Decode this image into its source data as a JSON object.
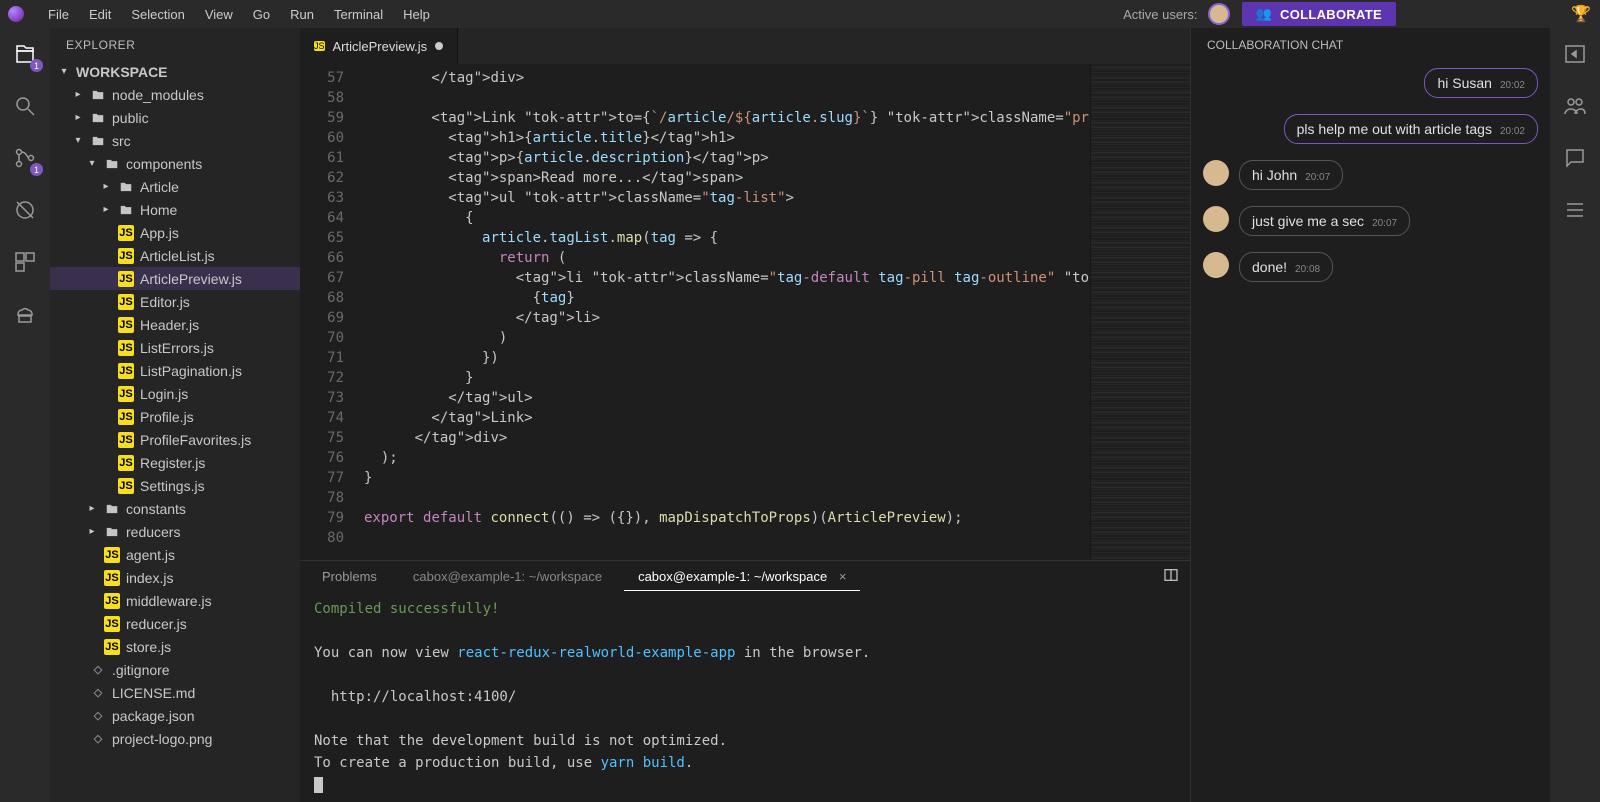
{
  "menu": {
    "items": [
      "File",
      "Edit",
      "Selection",
      "View",
      "Go",
      "Run",
      "Terminal",
      "Help"
    ],
    "activeUsersLabel": "Active users:",
    "collabButton": "COLLABORATE"
  },
  "explorer": {
    "title": "EXPLORER",
    "section": "WORKSPACE",
    "tree": [
      {
        "type": "folder",
        "label": "node_modules",
        "depth": 1,
        "open": false
      },
      {
        "type": "folder",
        "label": "public",
        "depth": 1,
        "open": false
      },
      {
        "type": "folder",
        "label": "src",
        "depth": 1,
        "open": true
      },
      {
        "type": "folder",
        "label": "components",
        "depth": 2,
        "open": true
      },
      {
        "type": "folder",
        "label": "Article",
        "depth": 3,
        "open": false
      },
      {
        "type": "folder",
        "label": "Home",
        "depth": 3,
        "open": false
      },
      {
        "type": "file",
        "label": "App.js",
        "depth": 3,
        "icon": "js"
      },
      {
        "type": "file",
        "label": "ArticleList.js",
        "depth": 3,
        "icon": "js"
      },
      {
        "type": "file",
        "label": "ArticlePreview.js",
        "depth": 3,
        "icon": "js",
        "selected": true
      },
      {
        "type": "file",
        "label": "Editor.js",
        "depth": 3,
        "icon": "js"
      },
      {
        "type": "file",
        "label": "Header.js",
        "depth": 3,
        "icon": "js"
      },
      {
        "type": "file",
        "label": "ListErrors.js",
        "depth": 3,
        "icon": "js"
      },
      {
        "type": "file",
        "label": "ListPagination.js",
        "depth": 3,
        "icon": "js"
      },
      {
        "type": "file",
        "label": "Login.js",
        "depth": 3,
        "icon": "js"
      },
      {
        "type": "file",
        "label": "Profile.js",
        "depth": 3,
        "icon": "js"
      },
      {
        "type": "file",
        "label": "ProfileFavorites.js",
        "depth": 3,
        "icon": "js"
      },
      {
        "type": "file",
        "label": "Register.js",
        "depth": 3,
        "icon": "js"
      },
      {
        "type": "file",
        "label": "Settings.js",
        "depth": 3,
        "icon": "js"
      },
      {
        "type": "folder",
        "label": "constants",
        "depth": 2,
        "open": false
      },
      {
        "type": "folder",
        "label": "reducers",
        "depth": 2,
        "open": false
      },
      {
        "type": "file",
        "label": "agent.js",
        "depth": 2,
        "icon": "js"
      },
      {
        "type": "file",
        "label": "index.js",
        "depth": 2,
        "icon": "js"
      },
      {
        "type": "file",
        "label": "middleware.js",
        "depth": 2,
        "icon": "js"
      },
      {
        "type": "file",
        "label": "reducer.js",
        "depth": 2,
        "icon": "js"
      },
      {
        "type": "file",
        "label": "store.js",
        "depth": 2,
        "icon": "js"
      },
      {
        "type": "file",
        "label": ".gitignore",
        "depth": 1,
        "icon": "generic"
      },
      {
        "type": "file",
        "label": "LICENSE.md",
        "depth": 1,
        "icon": "generic"
      },
      {
        "type": "file",
        "label": "package.json",
        "depth": 1,
        "icon": "generic"
      },
      {
        "type": "file",
        "label": "project-logo.png",
        "depth": 1,
        "icon": "generic"
      }
    ]
  },
  "activity": {
    "explorerBadge": "1",
    "scmBadge": "1"
  },
  "editor": {
    "tab": "ArticlePreview.js",
    "startLine": 57,
    "lines": [
      "        </div>",
      "",
      "        <Link to={`/article/${article.slug}`} className=\"preview-link\">",
      "          <h1>{article.title}</h1>",
      "          <p>{article.description}</p>",
      "          <span>Read more...</span>",
      "          <ul className=\"tag-list\">",
      "            {",
      "              article.tagList.map(tag => {",
      "                return (",
      "                  <li className=\"tag-default tag-pill tag-outline\" key={tag}>",
      "                    {tag}",
      "                  </li>",
      "                )",
      "              })",
      "            }",
      "          </ul>",
      "        </Link>",
      "      </div>",
      "  );",
      "}",
      "",
      "export default connect(() => ({}), mapDispatchToProps)(ArticlePreview);",
      ""
    ]
  },
  "panel": {
    "tabs": {
      "problems": "Problems",
      "term1": "cabox@example-1: ~/workspace",
      "term2": "cabox@example-1: ~/workspace"
    },
    "terminal": {
      "line1": "Compiled successfully!",
      "line2a": "You can now view ",
      "line2b": "react-redux-realworld-example-app",
      "line2c": " in the browser.",
      "line3": "  http://localhost:4100/",
      "line4": "Note that the development build is not optimized.",
      "line5a": "To create a production build, use ",
      "line5b": "yarn build",
      "line5c": "."
    }
  },
  "chat": {
    "title": "COLLABORATION CHAT",
    "messages": [
      {
        "side": "right",
        "text": "hi Susan",
        "time": "20:02"
      },
      {
        "side": "right",
        "text": "pls help me out with article tags",
        "time": "20:02"
      },
      {
        "side": "left",
        "text": "hi John",
        "time": "20:07"
      },
      {
        "side": "left",
        "text": "just give me a sec",
        "time": "20:07"
      },
      {
        "side": "left",
        "text": "done!",
        "time": "20:08"
      }
    ]
  }
}
